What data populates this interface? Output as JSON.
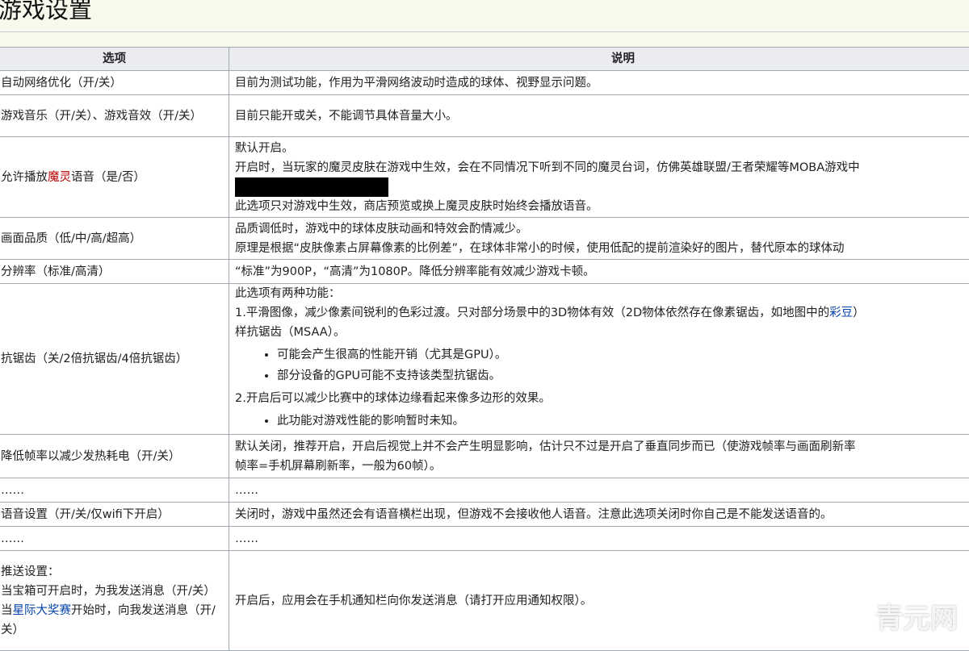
{
  "page": {
    "title": "游戏设置"
  },
  "table": {
    "headers": {
      "option": "选项",
      "description": "说明"
    },
    "rows": {
      "net": {
        "option": "自动网络优化（开/关）",
        "desc": [
          "目前为测试功能，作用为平滑网络波动时造成的球体、视野显示问题。"
        ]
      },
      "audio": {
        "option": "游戏音乐（开/关）、游戏音效（开/关）",
        "desc": [
          "目前只能开或关，不能调节具体音量大小。"
        ]
      },
      "voice": {
        "option_pre": "允许播放",
        "option_red": "魔灵",
        "option_post": "语音（是/否）",
        "desc": [
          "默认开启。",
          "开启时，当玩家的魔灵皮肤在游戏中生效，会在不同情况下听到不同的魔灵台词，仿佛英雄联盟/王者荣耀等MOBA游戏中",
          "此选项只对游戏中生效，商店预览或换上魔灵皮肤时始终会播放语音。"
        ]
      },
      "quality": {
        "option": "画面品质（低/中/高/超高）",
        "desc": [
          "品质调低时，游戏中的球体皮肤动画和特效会酌情减少。",
          "原理是根据“皮肤像素占屏幕像素的比例差”，在球体非常小的时候，使用低配的提前渲染好的图片，替代原本的球体动"
        ]
      },
      "resolution": {
        "option": "分辨率（标准/高清）",
        "desc": [
          "“标准”为900P，“高清”为1080P。降低分辨率能有效减少游戏卡顿。"
        ]
      },
      "aa": {
        "option": "抗锯齿（关/2倍抗锯齿/4倍抗锯齿）",
        "intro": "此选项有两种功能：",
        "p1_pre": "1.平滑图像，减少像素间锐利的色彩过渡。只对部分场景中的3D物体有效（2D物体依然存在像素锯齿，如地图中的",
        "p1_link": "彩豆",
        "p1_post": "）",
        "p1_cont": "样抗锯齿（MSAA）。",
        "bullets1": [
          "可能会产生很高的性能开销（尤其是GPU）。",
          "部分设备的GPU可能不支持该类型抗锯齿。"
        ],
        "p2": "2.开启后可以减少比赛中的球体边缘看起来像多边形的效果。",
        "bullets2": [
          "此功能对游戏性能的影响暂时未知。"
        ]
      },
      "fps": {
        "option": "降低帧率以减少发热耗电（开/关）",
        "desc": [
          "默认关闭，推荐开启，开启后视觉上并不会产生明显影响，估计只不过是开启了垂直同步而已（使游戏帧率与画面刷新率",
          "帧率=手机屏幕刷新率，一般为60帧）。"
        ]
      },
      "ellipsis1": {
        "option": "……",
        "desc": "……"
      },
      "voicechat": {
        "option": "语音设置（开/关/仅wifi下开启）",
        "desc": [
          "关闭时，游戏中虽然还会有语音横栏出现，但游戏不会接收他人语音。注意此选项关闭时你自己是不能发送语音的。"
        ]
      },
      "ellipsis2": {
        "option": "……",
        "desc": "……"
      },
      "push": {
        "option_l1": "推送设置：",
        "option_l2": "当宝箱可开启时，为我发送消息（开/关）",
        "option_l3_pre": "当",
        "option_l3_link": "星际大奖赛",
        "option_l3_post": "开始时，向我发送消息（开/关）",
        "desc": [
          "开启后，应用会在手机通知栏向你发送消息（请打开应用通知权限）。"
        ]
      }
    }
  },
  "watermark": {
    "text": "青元网",
    "icon": "search-q-icon"
  },
  "colors": {
    "background": "#f9f8ec",
    "header_bg": "#eaecf0",
    "border": "#a2a9b1",
    "link": "#0645ad",
    "red_link": "#ba0000"
  }
}
